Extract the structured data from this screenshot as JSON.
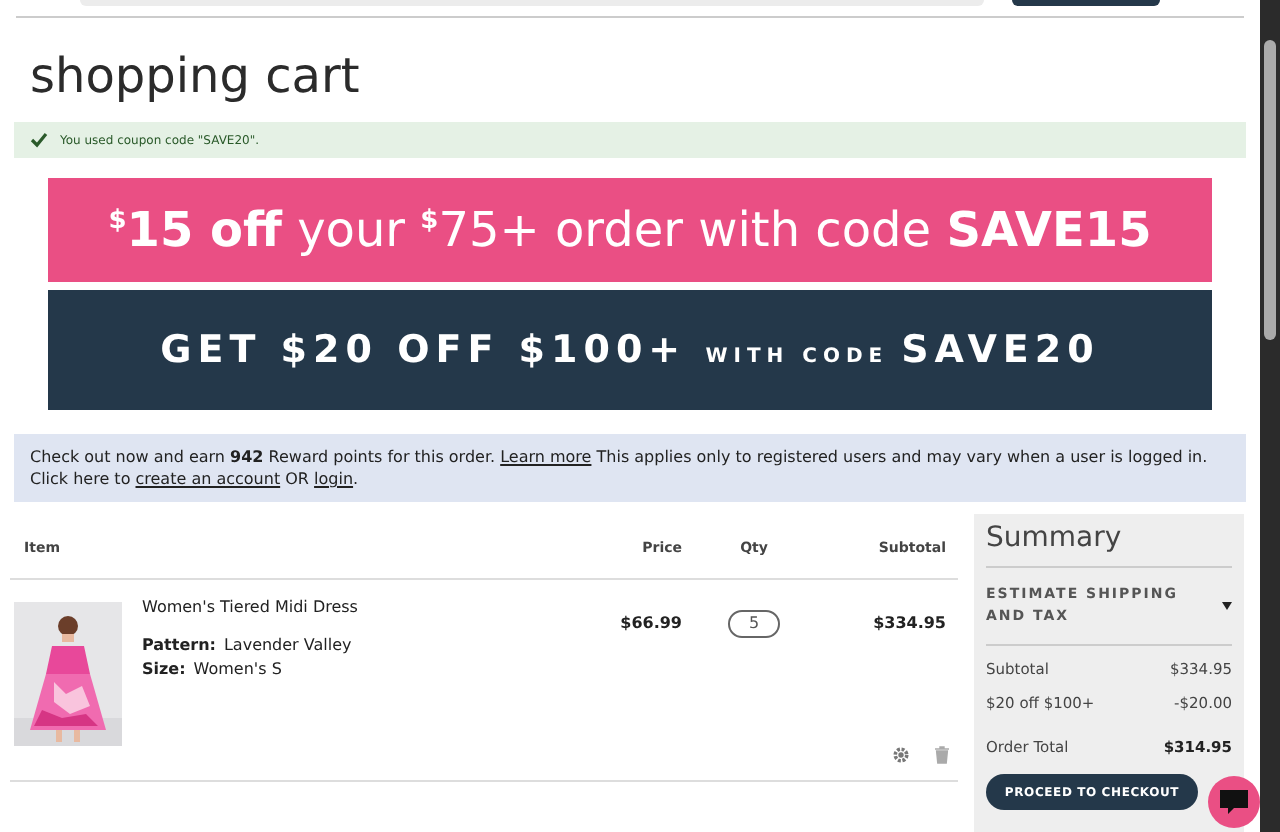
{
  "page": {
    "title": "shopping cart"
  },
  "message": {
    "kind": "success",
    "text": "You used coupon code \"SAVE20\"."
  },
  "banners": [
    {
      "kind": "pink",
      "parts": [
        {
          "kind": "sup",
          "text": "$"
        },
        {
          "kind": "bold",
          "text": "15 off"
        },
        {
          "kind": "plain",
          "text": " your "
        },
        {
          "kind": "sup",
          "text": "$"
        },
        {
          "kind": "plain",
          "text": "75+ order with code "
        },
        {
          "kind": "bold",
          "text": "SAVE15"
        }
      ]
    },
    {
      "kind": "dark",
      "parts": [
        {
          "kind": "big",
          "text": "GET $20 OFF $100+ "
        },
        {
          "kind": "small",
          "text": "WITH CODE "
        },
        {
          "kind": "big",
          "text": "SAVE20"
        }
      ]
    }
  ],
  "rewards": {
    "before": "Check out now and earn **942** Reward points for this order.",
    "learn_more": "Learn more",
    "middle": "This applies only to registered users and may vary when a user is logged in. Click here to",
    "create_account": "create an account",
    "or": "OR",
    "login": "login",
    "end": "."
  },
  "table": {
    "columns": [
      "Item",
      "Price",
      "Qty",
      "Subtotal"
    ],
    "rows": [
      {
        "name": "Women's Tiered Midi Dress",
        "options": [
          {
            "label": "Pattern:",
            "value": "Lavender Valley"
          },
          {
            "label": "Size:",
            "value": "Women's S"
          }
        ],
        "price": "$66.99",
        "qty": "5",
        "subtotal": "$334.95"
      }
    ]
  },
  "summary": {
    "title": "Summary",
    "estimate": {
      "label": "ESTIMATE SHIPPING AND TAX",
      "expanded": false
    },
    "lines": [
      {
        "label": "Subtotal",
        "value": "$334.95"
      },
      {
        "label": "$20 off $100+",
        "value": "-$20.00"
      }
    ],
    "total": {
      "label": "Order Total",
      "value": "$314.95"
    },
    "checkout": "PROCEED TO CHECKOUT"
  }
}
